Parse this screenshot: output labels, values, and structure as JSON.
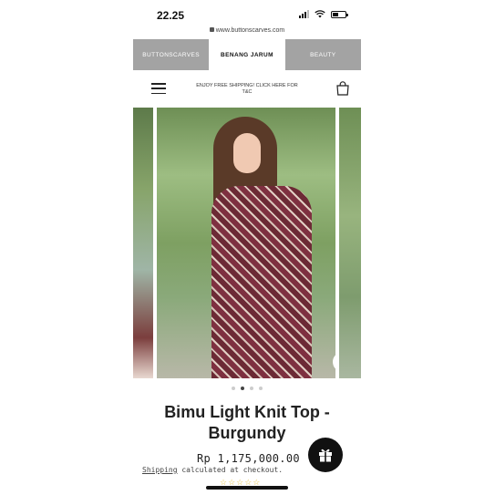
{
  "status_bar": {
    "time": "22.25"
  },
  "browser": {
    "url": "www.buttonscarves.com"
  },
  "brand_tabs": [
    {
      "label": "BUTTONSCARVES",
      "active": false
    },
    {
      "label": "BENANG JARUM",
      "active": true
    },
    {
      "label": "BEAUTY",
      "active": false
    }
  ],
  "header": {
    "promo_text": "ENJOY FREE SHIPPING! CLICK HERE FOR T&C",
    "menu_icon": "hamburger-menu-icon",
    "cart_icon": "shopping-bag-icon"
  },
  "gallery": {
    "zoom_icon": "magnifier-icon",
    "slide_count": 4,
    "active_slide": 2
  },
  "product": {
    "title": "Bimu Light Knit Top - Burgundy",
    "price": "Rp 1,175,000.00",
    "shipping_link": "Shipping",
    "shipping_rest": " calculated at checkout.",
    "rating_stars": "☆☆☆☆☆"
  },
  "floating": {
    "gift_icon": "gift-icon"
  },
  "colors": {
    "tab_inactive_bg": "#a3a3a3",
    "star_color": "#e7c44b",
    "gift_button_bg": "#111111"
  }
}
